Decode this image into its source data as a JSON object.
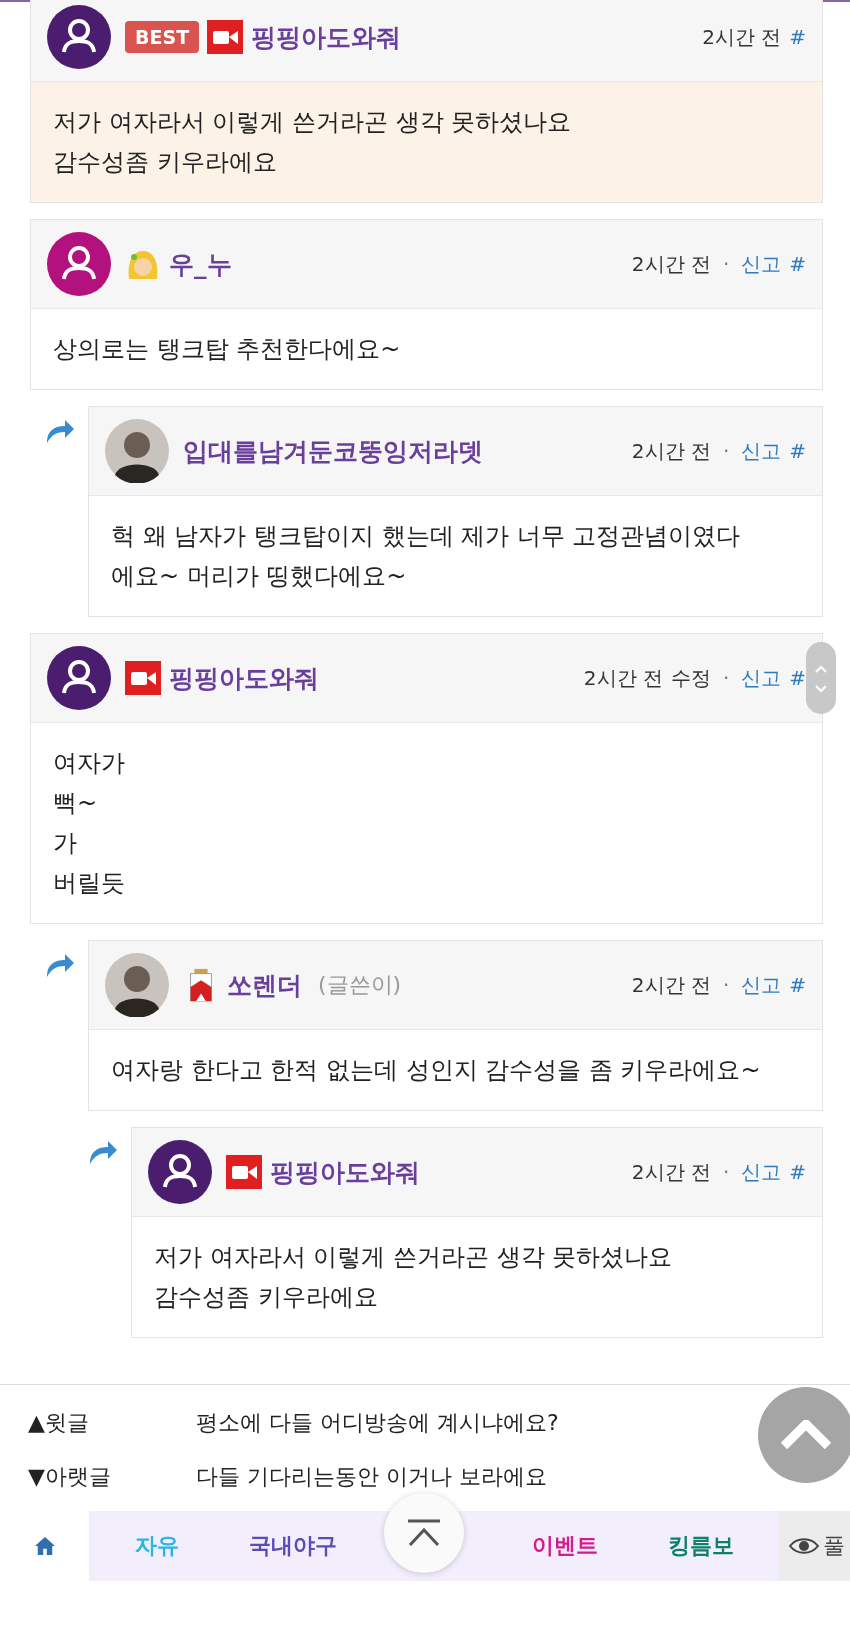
{
  "comments": [
    {
      "avatar": {
        "kind": "default",
        "color": "#4b1d6e"
      },
      "badge": "BEST",
      "icon": {
        "kind": "camera"
      },
      "name": "핑핑아도와줘",
      "time": "2시간 전",
      "anchor": "#",
      "best": true,
      "lines": [
        "저가 여자라서 이렇게 쓴거라곤 생각 못하셨나요",
        "감수성좀 키우라에요"
      ]
    },
    {
      "avatar": {
        "kind": "default",
        "color": "#b3127e"
      },
      "icon": {
        "kind": "girl"
      },
      "name": "우_누",
      "time": "2시간 전",
      "dot": "·",
      "report": "신고",
      "anchor": "#",
      "best": false,
      "lines": [
        "상의로는 탱크탑 추천한다에요~"
      ],
      "children": [
        {
          "avatar": {
            "kind": "photo"
          },
          "name": "입대를남겨둔코뚱잉저라뎃",
          "time": "2시간 전",
          "dot": "·",
          "report": "신고",
          "anchor": "#",
          "best": false,
          "lines": [
            "헉 왜 남자가 탱크탑이지 했는데 제가 너무 고정관념이였다",
            "에요~ 머리가 띵했다에요~"
          ]
        }
      ]
    },
    {
      "avatar": {
        "kind": "default",
        "color": "#4b1d6e"
      },
      "icon": {
        "kind": "camera"
      },
      "name": "핑핑아도와줘",
      "time": "2시간 전",
      "edited": "수정",
      "dot": "·",
      "report": "신고",
      "anchor": "#",
      "best": false,
      "scroller": true,
      "lines": [
        "여자가",
        "뻑~",
        "가",
        "버릴듯"
      ],
      "children": [
        {
          "avatar": {
            "kind": "photo"
          },
          "icon": {
            "kind": "pack"
          },
          "name": "쏘렌더",
          "tag": "(글쓴이)",
          "time": "2시간 전",
          "dot": "·",
          "report": "신고",
          "anchor": "#",
          "best": false,
          "lines": [
            "여자랑 한다고 한적 없는데 성인지 감수성을 좀 키우라에요~"
          ],
          "children": [
            {
              "avatar": {
                "kind": "default",
                "color": "#4b1d6e"
              },
              "icon": {
                "kind": "camera"
              },
              "name": "핑핑아도와줘",
              "time": "2시간 전",
              "dot": "·",
              "report": "신고",
              "anchor": "#",
              "best": false,
              "lines": [
                "저가 여자라서 이렇게 쓴거라곤 생각 못하셨나요",
                "감수성좀 키우라에요"
              ]
            }
          ]
        }
      ]
    }
  ],
  "post_nav": [
    {
      "label": "▲윗글",
      "title": "평소에 다들 어디방송에 계시냐에요?"
    },
    {
      "label": "▼아랫글",
      "title": "다들 기다리는동안 이거나 보라에요"
    }
  ],
  "menu": [
    {
      "label": "자유",
      "color": "#2bb5e0"
    },
    {
      "label": "국내야구",
      "color": "#5b4bb8"
    },
    {
      "label": "이벤트",
      "color": "#d41d8c"
    },
    {
      "label": "킹름보",
      "color": "#11806a"
    }
  ],
  "menu_extra": "풀"
}
